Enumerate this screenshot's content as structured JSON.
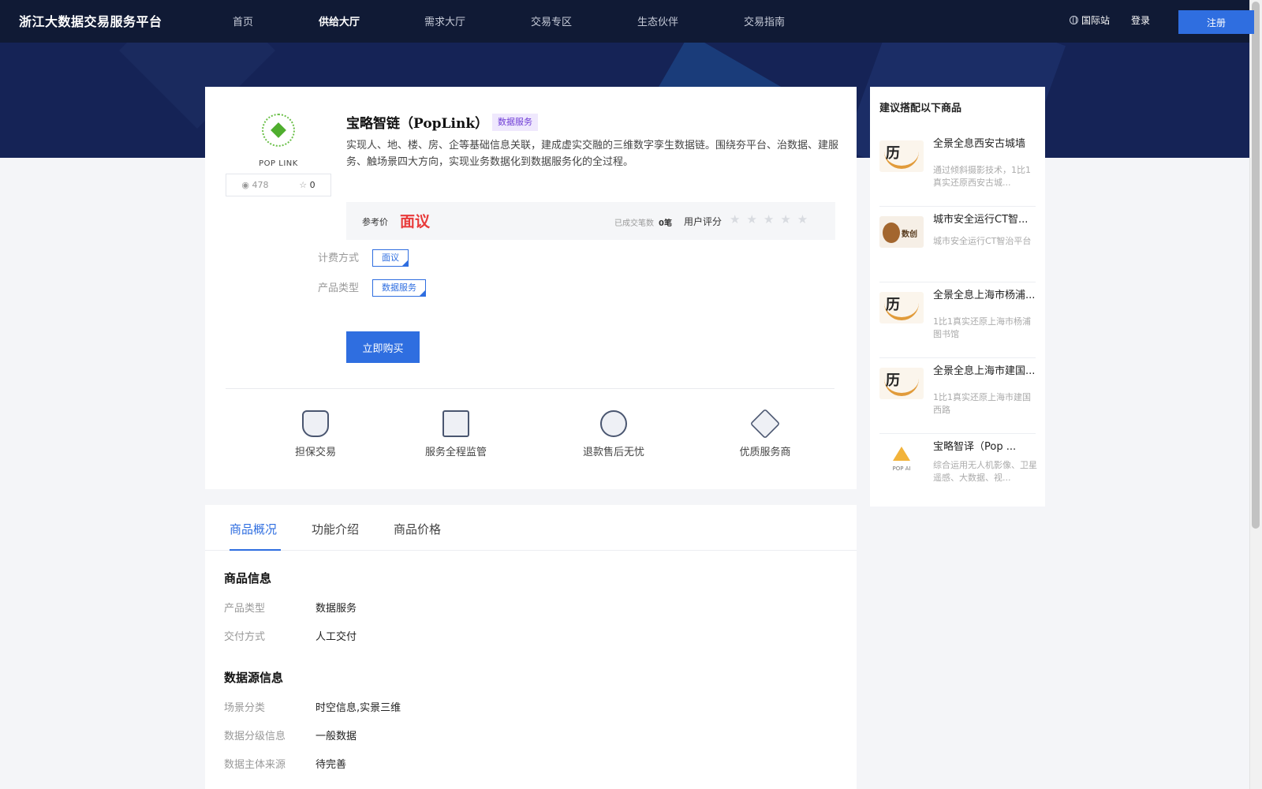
{
  "header": {
    "brand": "浙江大数据交易服务平台",
    "nav": [
      {
        "label": "首页",
        "active": false
      },
      {
        "label": "供给大厅",
        "active": true
      },
      {
        "label": "需求大厅",
        "active": false
      },
      {
        "label": "交易专区",
        "active": false
      },
      {
        "label": "生态伙伴",
        "active": false
      },
      {
        "label": "交易指南",
        "active": false
      }
    ],
    "intl": "国际站",
    "login": "登录",
    "register": "注册",
    "accent_color": "#2f6ee0"
  },
  "product": {
    "logo_text": "POP LINK",
    "views": "478",
    "stars": "0",
    "title": "宝略智链（PopLink）",
    "type_badge": "数据服务",
    "description": "实现人、地、楼、房、企等基础信息关联，建成虚实交融的三维数字孪生数据链。围绕夯平台、治数据、建服务、触场景四大方向，实现业务数据化到数据服务化的全过程。",
    "price_label": "参考价",
    "price_value": "面议",
    "trade_count_label": "已成交笔数",
    "trade_count_value": "0笔",
    "rating_label": "用户评分",
    "rating_stars": "★★★★★",
    "rating_value": 0,
    "billing_label": "计费方式",
    "billing_value": "面议",
    "product_type_label": "产品类型",
    "product_type_value": "数据服务",
    "buy_button": "立即购买",
    "features": [
      {
        "label": "担保交易",
        "icon": "shield-icon"
      },
      {
        "label": "服务全程监管",
        "icon": "monitor-icon"
      },
      {
        "label": "退款售后无忧",
        "icon": "chat-icon"
      },
      {
        "label": "优质服务商",
        "icon": "diamond-icon"
      }
    ]
  },
  "sidebar": {
    "title": "建议搭配以下商品",
    "items": [
      {
        "name": "全景全息西安古城墙",
        "desc": "通过倾斜摄影技术，1比1真实还原西安古城..."
      },
      {
        "name": "城市安全运行CT智...",
        "desc": "城市安全运行CT智治平台"
      },
      {
        "name": "全景全息上海市杨浦...",
        "desc": "1比1真实还原上海市杨浦图书馆"
      },
      {
        "name": "全景全息上海市建国...",
        "desc": "1比1真实还原上海市建国西路"
      },
      {
        "name": "宝略智译（Pop ...",
        "desc": "综合运用无人机影像、卫星遥感、大数据、视..."
      }
    ]
  },
  "detail": {
    "tabs": [
      {
        "label": "商品概况",
        "active": true
      },
      {
        "label": "功能介绍",
        "active": false
      },
      {
        "label": "商品价格",
        "active": false
      }
    ],
    "product_info_title": "商品信息",
    "product_info": [
      {
        "label": "产品类型",
        "value": "数据服务"
      },
      {
        "label": "交付方式",
        "value": "人工交付"
      }
    ],
    "source_info_title": "数据源信息",
    "source_info": [
      {
        "label": "场景分类",
        "value": "时空信息,实景三维"
      },
      {
        "label": "数据分级信息",
        "value": "一般数据"
      },
      {
        "label": "数据主体来源",
        "value": "待完善"
      }
    ]
  }
}
